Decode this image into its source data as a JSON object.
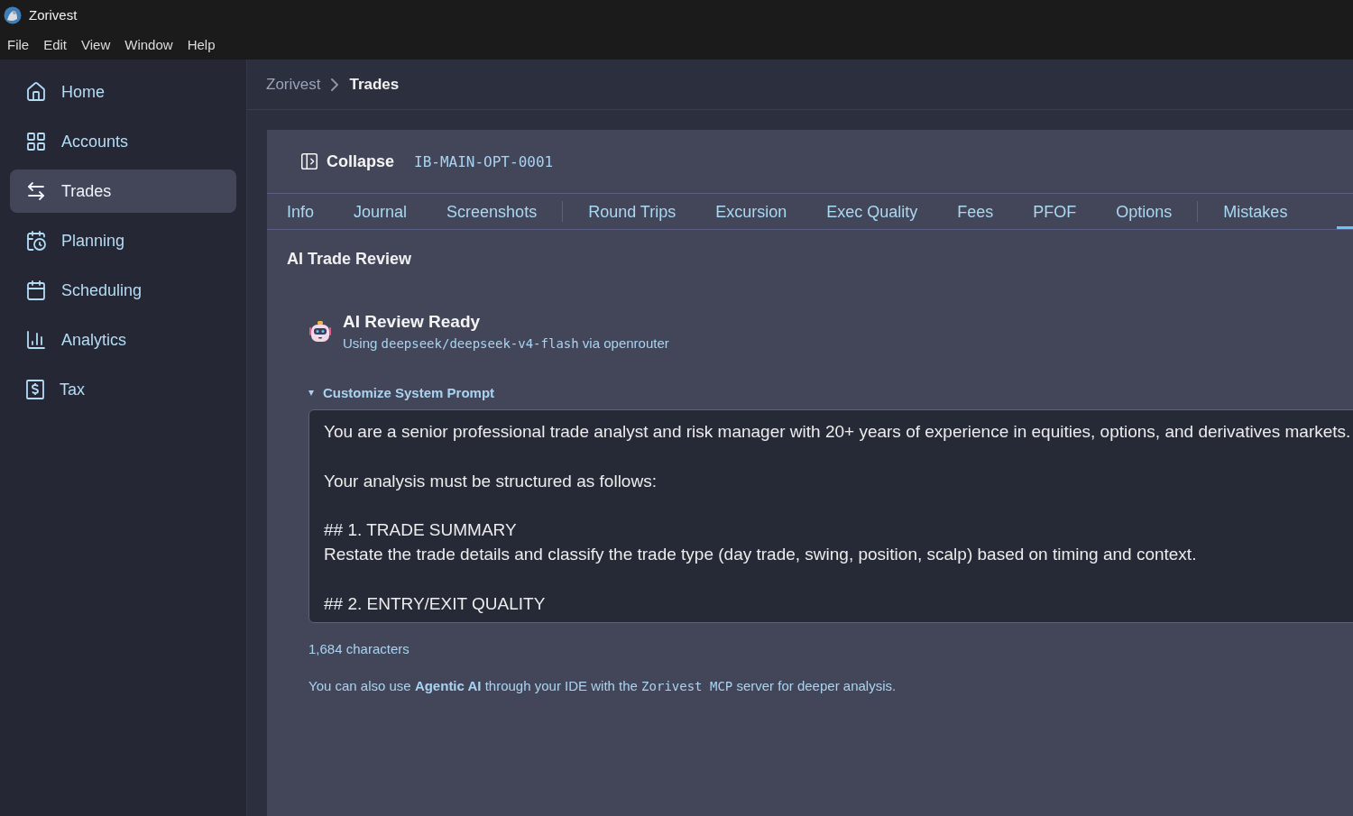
{
  "window": {
    "title": "Zorivest"
  },
  "menu": [
    "File",
    "Edit",
    "View",
    "Window",
    "Help"
  ],
  "sidebar": {
    "items": [
      {
        "label": "Home",
        "selected": false
      },
      {
        "label": "Accounts",
        "selected": false
      },
      {
        "label": "Trades",
        "selected": true
      },
      {
        "label": "Planning",
        "selected": false
      },
      {
        "label": "Scheduling",
        "selected": false
      },
      {
        "label": "Analytics",
        "selected": false
      },
      {
        "label": "Tax",
        "selected": false
      }
    ]
  },
  "breadcrumb": [
    "Zorivest",
    "Trades"
  ],
  "panel": {
    "collapse_label": "Collapse",
    "trade_id": "IB-MAIN-OPT-0001",
    "tabs": [
      {
        "label": "Info",
        "selected": false
      },
      {
        "label": "Journal",
        "selected": false
      },
      {
        "label": "Screenshots",
        "selected": false,
        "divider_after": true
      },
      {
        "label": "Round Trips",
        "selected": false
      },
      {
        "label": "Excursion",
        "selected": false
      },
      {
        "label": "Exec Quality",
        "selected": false
      },
      {
        "label": "Fees",
        "selected": false
      },
      {
        "label": "PFOF",
        "selected": false
      },
      {
        "label": "Options",
        "selected": false,
        "divider_after": true
      },
      {
        "label": "Mistakes",
        "selected": false
      }
    ],
    "offscreen_tab": {
      "selected": true
    },
    "section_title": "AI Trade Review",
    "status": {
      "title": "AI Review Ready",
      "parts": [
        {
          "kind": "text",
          "text": "Using "
        },
        {
          "kind": "code",
          "text": "deepseek/deepseek-v4-flash"
        },
        {
          "kind": "text",
          "text": " via openrouter"
        }
      ]
    },
    "prompt": {
      "label": "Customize System Prompt",
      "expanded": true,
      "value": "You are a senior professional trade analyst and risk manager with 20+ years of experience in equities, options, and derivatives markets.\n\nYour analysis must be structured as follows:\n\n## 1. TRADE SUMMARY\nRestate the trade details and classify the trade type (day trade, swing, position, scalp) based on timing and context.\n\n## 2. ENTRY/EXIT QUALITY",
      "count": "1,684 characters"
    },
    "footer": [
      {
        "kind": "text",
        "text": "You can also use "
      },
      {
        "kind": "bold",
        "text": "Agentic AI"
      },
      {
        "kind": "text",
        "text": " through your IDE with the "
      },
      {
        "kind": "code",
        "text": "Zorivest MCP"
      },
      {
        "kind": "text",
        "text": " server for deeper analysis."
      }
    ]
  }
}
